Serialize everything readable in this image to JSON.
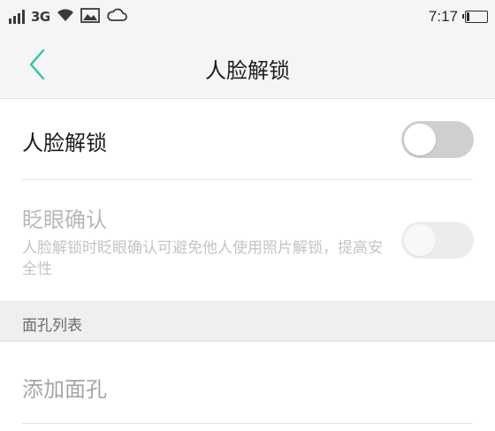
{
  "status_bar": {
    "network": "3G",
    "time": "7:17",
    "icons": [
      "signal-icon",
      "wifi-icon",
      "image-icon",
      "cloud-icon",
      "battery-icon"
    ],
    "battery_level": 0.15
  },
  "header": {
    "title": "人脸解锁",
    "back_icon": "chevron-left-icon",
    "accent_color": "#2bc4a4"
  },
  "settings": {
    "face_unlock": {
      "label": "人脸解锁",
      "enabled": false
    },
    "blink_confirm": {
      "label": "眨眼确认",
      "description": "人脸解锁时眨眼确认可避免他人使用照片解锁，提高安全性",
      "enabled": false,
      "disabled": true
    }
  },
  "face_list": {
    "section_title": "面孔列表",
    "add_label": "添加面孔"
  }
}
